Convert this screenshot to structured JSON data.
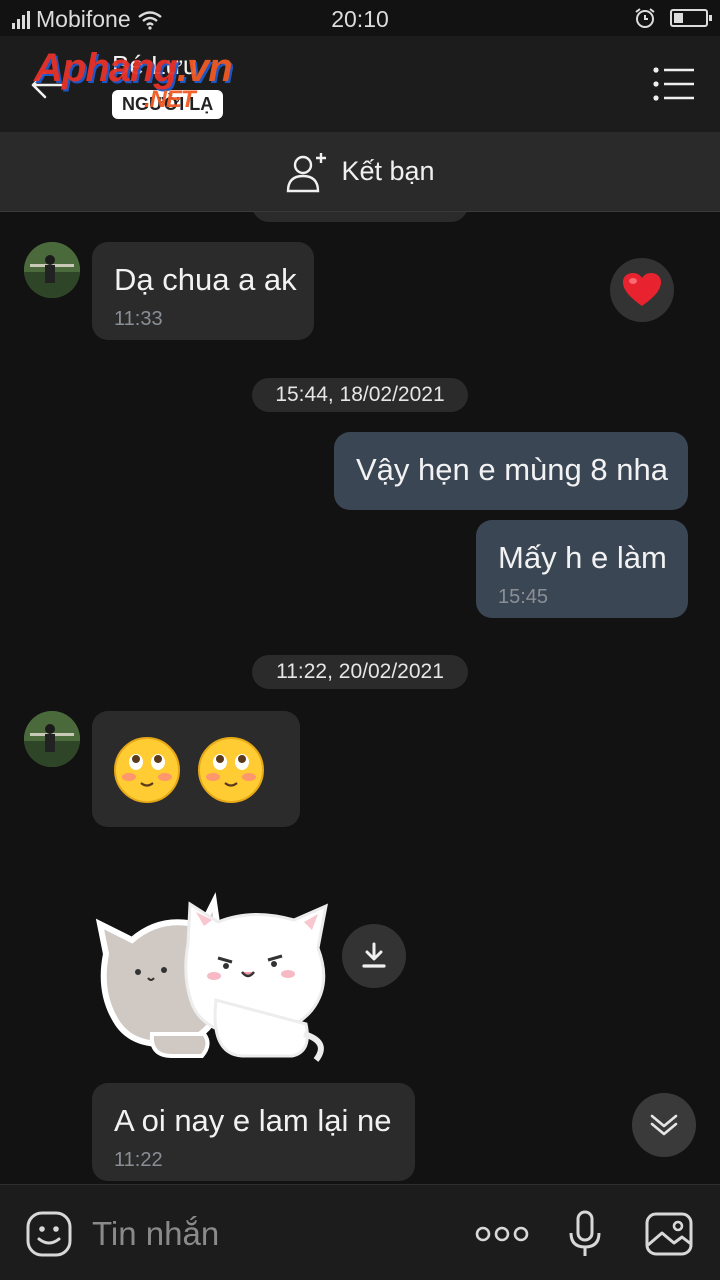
{
  "status_bar": {
    "carrier": "Mobifone",
    "time": "20:10",
    "battery_level": 0.3
  },
  "header": {
    "title": "Bé Lưu",
    "subtitle": "NGƯỜI LẠ",
    "watermark": {
      "main": "Aphang",
      "suffix": ".vn",
      "sub": ".NET"
    }
  },
  "friend_bar": {
    "label": "Kết bạn",
    "icon": "add-user-icon"
  },
  "messages": [
    {
      "direction": "in",
      "text": "Dạ chua a ak",
      "time": "11:33",
      "reaction": "heart-icon"
    },
    {
      "type": "date",
      "text": "15:44, 18/02/2021"
    },
    {
      "direction": "out",
      "text": "Vậy hẹn e mùng 8 nha"
    },
    {
      "direction": "out",
      "text": "Mấy h e làm",
      "time": "15:45"
    },
    {
      "type": "date",
      "text": "11:22, 20/02/2021"
    },
    {
      "direction": "in",
      "type": "emoji",
      "emojis": [
        "blushing-face-icon",
        "blushing-face-icon"
      ]
    },
    {
      "direction": "in",
      "type": "sticker",
      "sticker": "cats-hug-sticker"
    },
    {
      "direction": "in",
      "text": "A oi nay e lam lại ne",
      "time": "11:22"
    }
  ],
  "input": {
    "placeholder": "Tin nhắn",
    "icons": [
      "emoji-icon",
      "more-icon",
      "microphone-icon",
      "image-icon"
    ]
  },
  "colors": {
    "background": "#121212",
    "incoming_bubble": "#2b2b2b",
    "outgoing_bubble": "#3b4654",
    "heart": "#e8232f"
  }
}
